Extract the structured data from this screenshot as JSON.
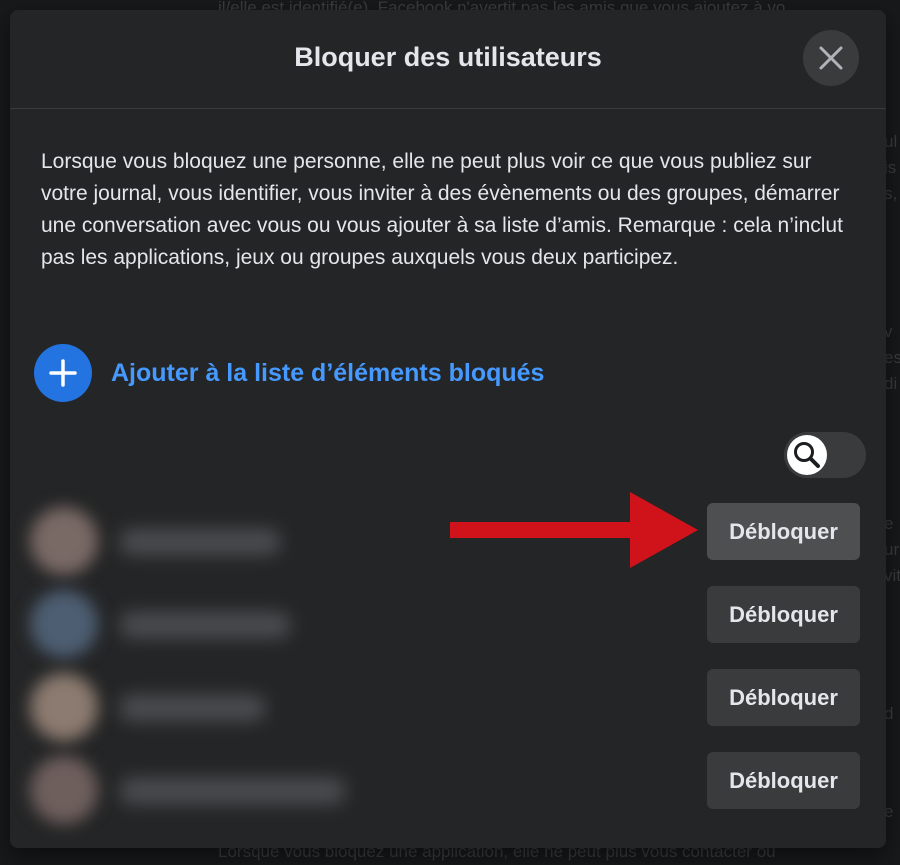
{
  "background": {
    "top_text": "il/elle est identifié(e), Facebook n'avertit pas les amis que vous ajoutez à vo",
    "bottom_text": "Lorsque vous bloquez une application, elle ne peut plus vous contacter ou",
    "side_fragments": [
      "ul",
      "is",
      "s,",
      "v",
      "es",
      "di",
      "e",
      "ur",
      "vit",
      "d",
      "e"
    ]
  },
  "dialog": {
    "title": "Bloquer des utilisateurs",
    "close_icon": "close-icon",
    "description": "Lorsque vous bloquez une personne, elle ne peut plus voir ce que vous publiez sur votre journal, vous identifier, vous inviter à des évènements ou des groupes, démarrer une conversation avec vous ou vous ajouter à sa liste d’amis. Remarque : cela n’inclut pas les applications, jeux ou groupes auxquels vous deux participez.",
    "add_label": "Ajouter à la liste d’éléments bloqués",
    "add_icon": "plus-icon",
    "search_icon": "search-icon",
    "users": [
      {
        "unblock_label": "Débloquer"
      },
      {
        "unblock_label": "Débloquer"
      },
      {
        "unblock_label": "Débloquer"
      },
      {
        "unblock_label": "Débloquer"
      }
    ]
  },
  "colors": {
    "accent_blue": "#2374e1",
    "link_blue": "#4599ff",
    "arrow_red": "#d0121b",
    "dialog_bg": "#242526"
  }
}
